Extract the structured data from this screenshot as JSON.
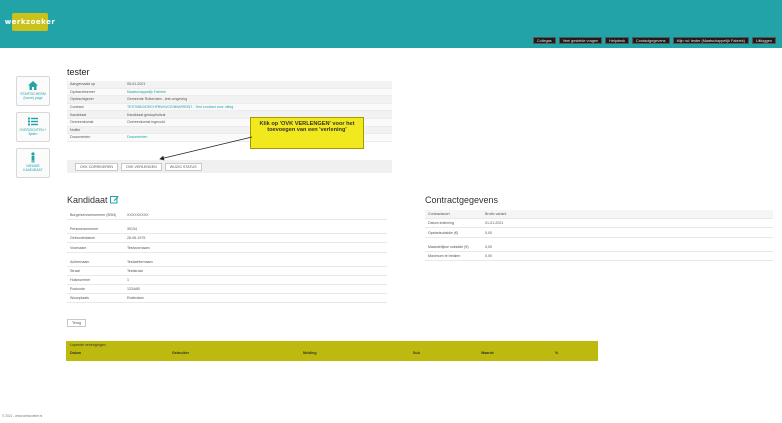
{
  "header": {
    "logo_text": "werkzoeker",
    "nav": [
      "Collegas",
      "Veel gestelde vragen",
      "Helpdesk",
      "Contactgegevens",
      "Mijn rol: tester (Maatschappelijk Fabriek)",
      "Uitloggen"
    ]
  },
  "sidebar": {
    "items": [
      {
        "label": "STARTSCHERM (home) page",
        "icon": "home-icon"
      },
      {
        "label": "OVERZICHTEN + lijsten",
        "icon": "list-icon"
      },
      {
        "label": "NIEUWE KANDIDAAT",
        "icon": "person-icon"
      }
    ]
  },
  "main": {
    "title": "tester",
    "info": [
      {
        "key": "Aangemaakt op",
        "value": "05-01-2021"
      },
      {
        "key": "Opdrachtnemer",
        "value": "Maatschappelijk Fabriek",
        "link": true
      },
      {
        "key": "Opdrachtgever",
        "value": "Gemeente Rotterdam - test omgeving"
      },
      {
        "key": "Contract",
        "value": "TESTMBO/DRCHFBWO/CR/BWI/REINT - Test contract voor uitleg",
        "link": true
      },
      {
        "key": "Kandidaat",
        "value": "Kandidaat gestopt/uitval"
      },
      {
        "key": "Overeenkomst",
        "value": "Overeenkomst ingevuld"
      },
      {
        "key": "Notitie",
        "value": ""
      },
      {
        "key": "Documenten",
        "value": "Documenten",
        "link": true
      }
    ],
    "buttons": [
      "OVK CORRIGEREN",
      "OVK VERLENGEN",
      "WIJZIG STATUS"
    ],
    "callout": "Klik op 'OVK VERLENGEN' voor het toevoegen van een 'verlening'"
  },
  "kandidaat": {
    "title": "Kandidaat",
    "rows": [
      {
        "key": "Burgerservicenummer (BSN)",
        "value": "XXXXXXXXX"
      },
      {
        "key": "Persoonsnummer",
        "value": "30134"
      },
      {
        "key": "Geboortedatum",
        "value": "26-06-1975"
      },
      {
        "key": "Voornaam",
        "value": "Testvoornaam"
      },
      {
        "key": "Achternaam",
        "value": "Testachternaam"
      },
      {
        "key": "Straat",
        "value": "Teststraat"
      },
      {
        "key": "Huisnummer",
        "value": "1"
      },
      {
        "key": "Postcode",
        "value": "1234AB"
      },
      {
        "key": "Woonplaats",
        "value": "Rotterdam"
      }
    ]
  },
  "contract": {
    "title": "Contractgegevens",
    "rows": [
      {
        "key": "Contractsoort",
        "value": "Brutto variant"
      },
      {
        "key": "Datum indiening",
        "value": "01-01-2021"
      },
      {
        "key": "Opstartsubsidie (€)",
        "value": "0,00"
      },
      {
        "key": "Maandelijkse subsidie (€)",
        "value": "0,00"
      },
      {
        "key": "Maximum te betalen",
        "value": "0,00"
      }
    ]
  },
  "small_button": "Terug",
  "table": {
    "caption": "Lopende verlengingen",
    "headers": [
      "Datum",
      "Gebruiker",
      "Melding",
      "Sub",
      "Waarde",
      "%"
    ]
  },
  "footer": "© 2021 - www.werkzoeker.nl"
}
